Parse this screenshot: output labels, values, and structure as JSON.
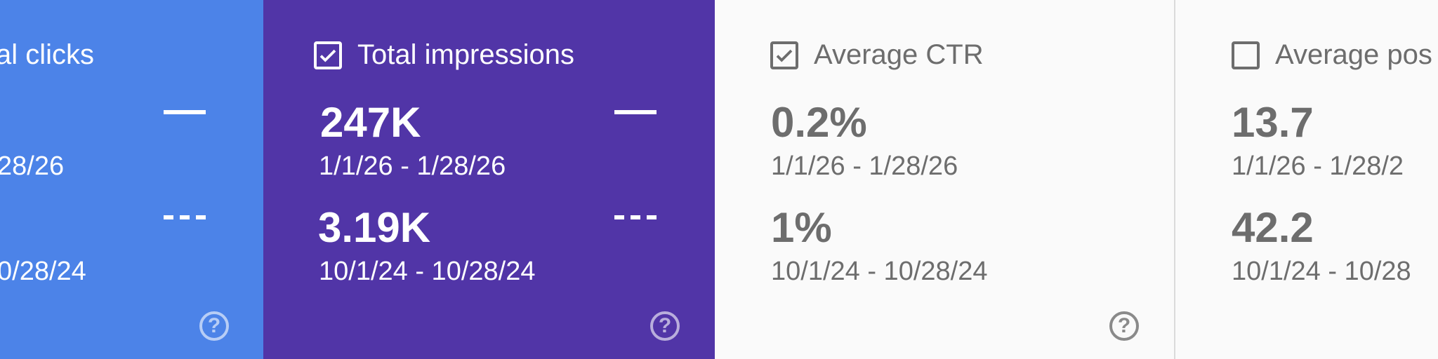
{
  "colors": {
    "clicks_bg": "#4c83e8",
    "impressions_bg": "#5135a7",
    "inactive_bg": "#fafafa",
    "inactive_text": "#6d6d6d"
  },
  "cards": {
    "clicks": {
      "label": "al clicks",
      "checked": true,
      "value1": "",
      "date1": "28/26",
      "value2": "",
      "date2": "0/28/24",
      "icon": "help-circle-icon",
      "help_glyph": "?"
    },
    "impressions": {
      "label": "Total impressions",
      "checked": true,
      "value1": "247K",
      "date1": "1/1/26 - 1/28/26",
      "value2": "3.19K",
      "date2": "10/1/24 - 10/28/24",
      "icon": "help-circle-icon",
      "help_glyph": "?"
    },
    "ctr": {
      "label": "Average CTR",
      "checked": true,
      "value1": "0.2%",
      "date1": "1/1/26 - 1/28/26",
      "value2": "1%",
      "date2": "10/1/24 - 10/28/24",
      "icon": "help-circle-icon",
      "help_glyph": "?"
    },
    "position": {
      "label": "Average pos",
      "checked": false,
      "value1": "13.7",
      "date1": "1/1/26 - 1/28/2",
      "value2": "42.2",
      "date2": "10/1/24 - 10/28"
    }
  }
}
